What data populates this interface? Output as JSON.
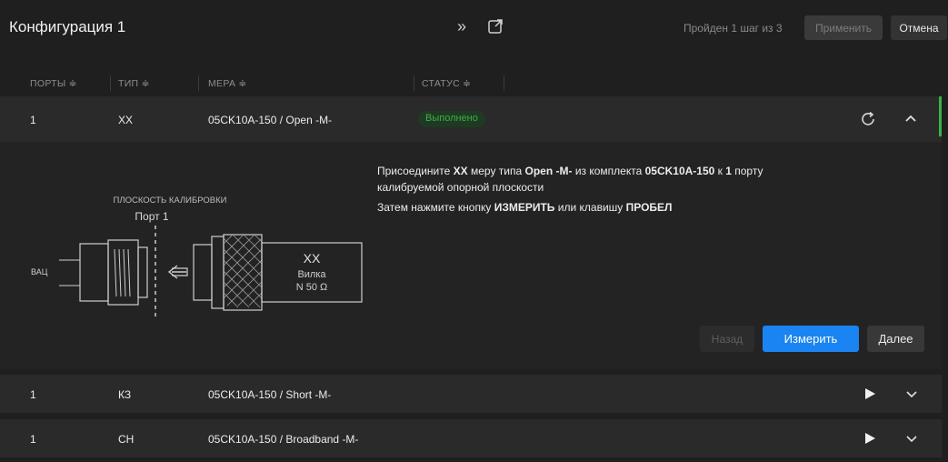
{
  "header": {
    "title": "Конфигурация 1",
    "steps_text": "Пройден 1 шаг из 3",
    "apply_label": "Применить",
    "cancel_label": "Отмена"
  },
  "columns": [
    {
      "label": "ПОРТЫ ≑"
    },
    {
      "label": "ТИП ≑"
    },
    {
      "label": "МЕРА ≑"
    },
    {
      "label": "СТАТУС ≑"
    }
  ],
  "rows": [
    {
      "port": "1",
      "type": "XX",
      "measure": "05CK10A-150 / Open -M-",
      "status": "Выполнено"
    },
    {
      "port": "1",
      "type": "КЗ",
      "measure": "05CK10A-150 / Short -M-",
      "status": ""
    },
    {
      "port": "1",
      "type": "CH",
      "measure": "05CK10A-150 / Broadband -M-",
      "status": ""
    }
  ],
  "diagram": {
    "plane_label": "ПЛОСКОСТЬ КАЛИБРОВКИ",
    "port_label": "Порт 1",
    "vna_label": "ВАЦ",
    "standard_type": "XX",
    "standard_gender": "Вилка",
    "standard_connector": "N 50 Ω"
  },
  "instructions": {
    "line1_a": "Присоедините ",
    "line1_b": "XX",
    "line1_c": "  меру типа ",
    "line1_d": "Open -M-",
    "line1_e": "  из комплекта ",
    "line1_f": "05CK10A-150",
    "line1_g": "  к ",
    "line1_h": "1",
    "line1_i": " порту",
    "line2": "калибруемой опорной плоскости",
    "line3_a": "Затем нажмите кнопку ",
    "line3_b": "ИЗМЕРИТЬ",
    "line3_c": " или клавишу ",
    "line3_d": "ПРОБЕЛ"
  },
  "actions": {
    "back_label": "Назад",
    "measure_label": "Измерить",
    "next_label": "Далее"
  },
  "colors": {
    "accent_blue": "#1a84f2",
    "success_green": "#3cae48",
    "background": "#1f1f1f"
  },
  "icons": [
    "expand-icon",
    "popout-icon",
    "refresh-icon",
    "chevron-up-icon",
    "play-icon",
    "chevron-down-icon"
  ]
}
